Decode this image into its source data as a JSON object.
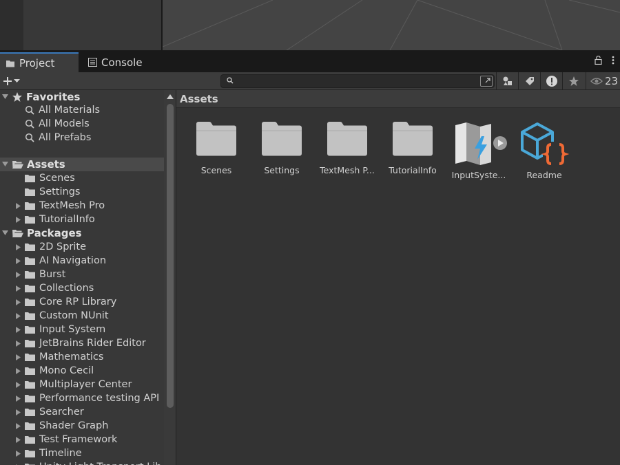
{
  "tabs": [
    {
      "label": "Project",
      "icon": "folder-icon",
      "active": true
    },
    {
      "label": "Console",
      "icon": "console-icon",
      "active": false
    }
  ],
  "toolbar": {
    "add_label": "+",
    "search": {
      "value": "",
      "placeholder": ""
    },
    "hidden_count": "23"
  },
  "tree": {
    "favorites": {
      "label": "Favorites",
      "items": [
        "All Materials",
        "All Models",
        "All Prefabs"
      ]
    },
    "assets": {
      "label": "Assets",
      "items": [
        {
          "label": "Scenes",
          "expandable": false
        },
        {
          "label": "Settings",
          "expandable": false
        },
        {
          "label": "TextMesh Pro",
          "expandable": true
        },
        {
          "label": "TutorialInfo",
          "expandable": true
        }
      ]
    },
    "packages": {
      "label": "Packages",
      "items": [
        "2D Sprite",
        "AI Navigation",
        "Burst",
        "Collections",
        "Core RP Library",
        "Custom NUnit",
        "Input System",
        "JetBrains Rider Editor",
        "Mathematics",
        "Mono Cecil",
        "Multiplayer Center",
        "Performance testing API",
        "Searcher",
        "Shader Graph",
        "Test Framework",
        "Timeline",
        "Unity Light Transport Lib"
      ]
    }
  },
  "breadcrumb": "Assets",
  "assets": [
    {
      "label": "Scenes",
      "type": "folder"
    },
    {
      "label": "Settings",
      "type": "folder"
    },
    {
      "label": "TextMesh P...",
      "type": "folder"
    },
    {
      "label": "TutorialInfo",
      "type": "folder"
    },
    {
      "label": "InputSyste...",
      "type": "input-actions"
    },
    {
      "label": "Readme",
      "type": "readme"
    }
  ],
  "colors": {
    "accent": "#3a79bb",
    "readme_blue": "#4aa8d8",
    "readme_orange": "#f06a35",
    "input_bolt": "#3aa0e0"
  }
}
